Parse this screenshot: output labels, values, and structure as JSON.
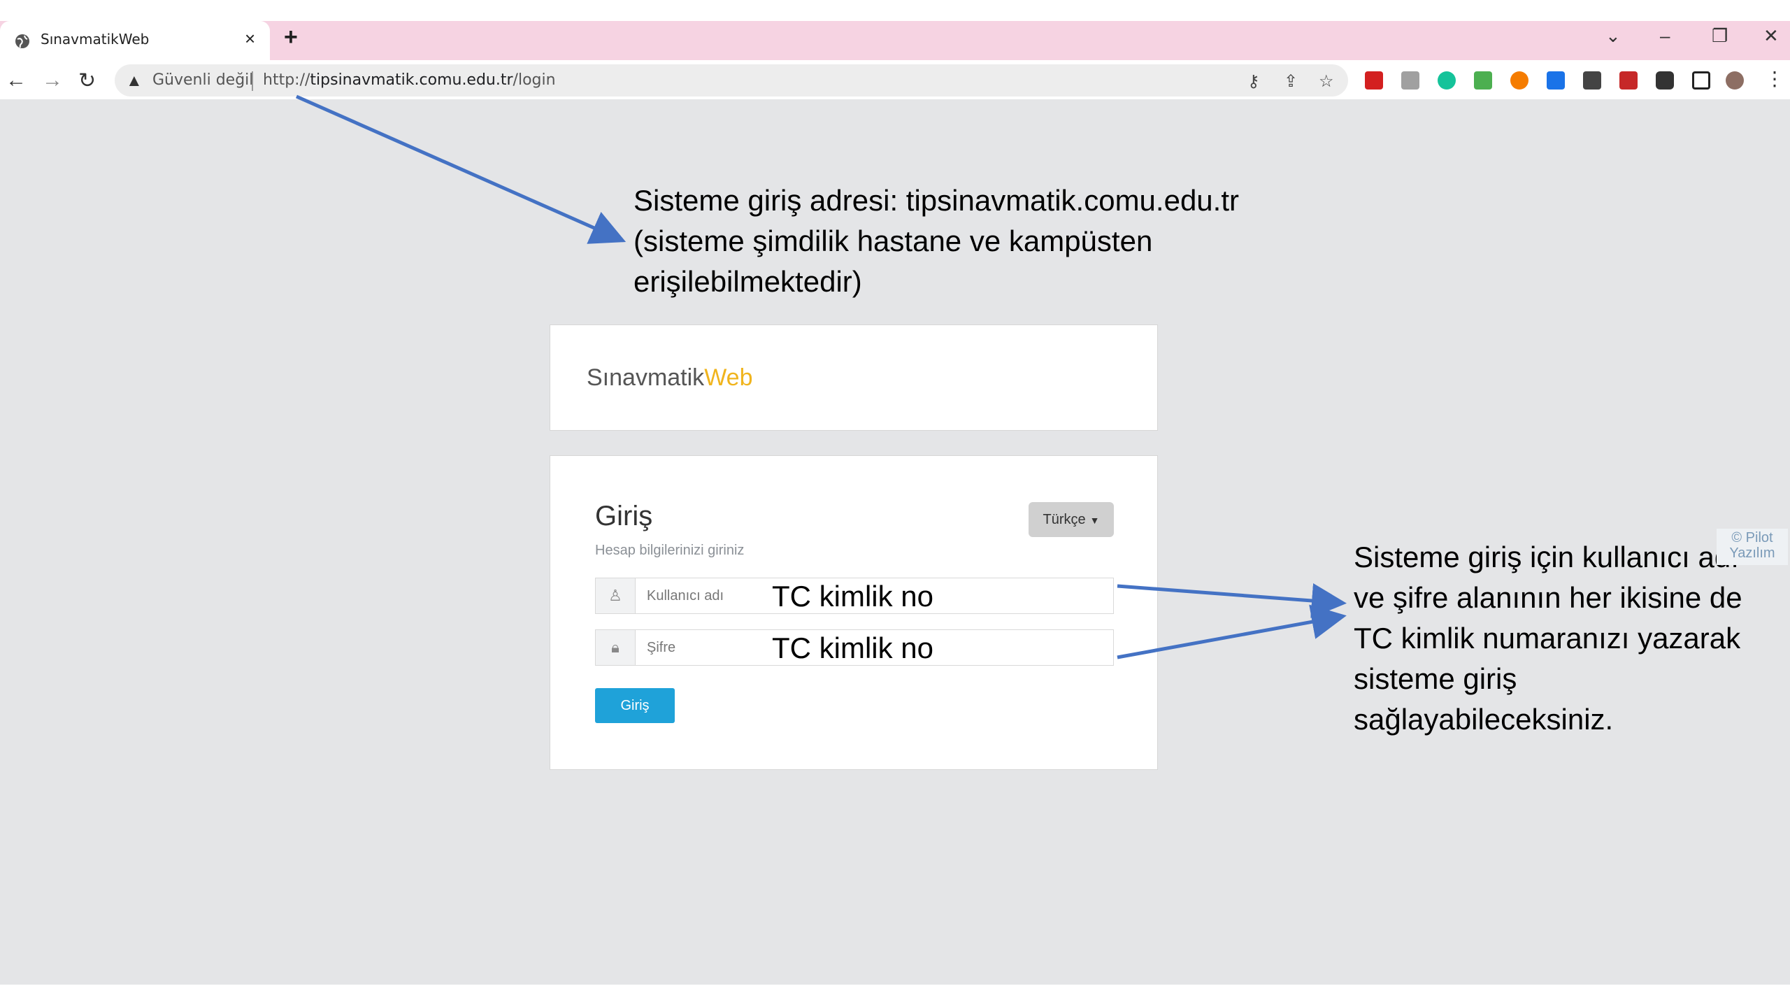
{
  "browser": {
    "tab_title": "SınavmatikWeb",
    "tab_close": "×",
    "new_tab": "+",
    "security_label": "Güvenli değil",
    "url_prefix": "http://",
    "url_host": "tipsinavmatik.comu.edu.tr",
    "url_path": "/login",
    "window_controls": {
      "tab_search": "⌄",
      "minimize": "–",
      "restore": "❐",
      "close": "✕"
    },
    "nav": {
      "back": "←",
      "forward": "→",
      "reload": "↻"
    },
    "omnibox_icons": {
      "key": "⚷",
      "share": "⇪",
      "star": "☆"
    },
    "menu": "⋮",
    "colors": {
      "tabstrip": "#f6d3e2",
      "viewport": "#e4e5e7"
    }
  },
  "app": {
    "brand_main": "Sınavmatik",
    "brand_accent": "Web",
    "accent_color": "#f0b41d",
    "login": {
      "title": "Giriş",
      "subtitle": "Hesap bilgilerinizi giriniz",
      "language": "Türkçe",
      "username_placeholder": "Kullanıcı adı",
      "password_placeholder": "Şifre",
      "username_note": "TC kimlik no",
      "password_note": "TC kimlik no",
      "submit": "Giriş",
      "submit_color": "#1fa2d9"
    }
  },
  "annotations": {
    "top": "Sisteme giriş adresi: tipsinavmatik.comu.edu.tr (sisteme şimdilik hastane ve kampüsten erişilebilmektedir)",
    "right": "Sisteme giriş için kullanıcı adı ve şifre alanının her ikisine de TC kimlik numaranızı yazarak sisteme giriş sağlayabileceksiniz.",
    "arrow_color": "#4472c4"
  },
  "watermark": "© Pilot Yazılım"
}
